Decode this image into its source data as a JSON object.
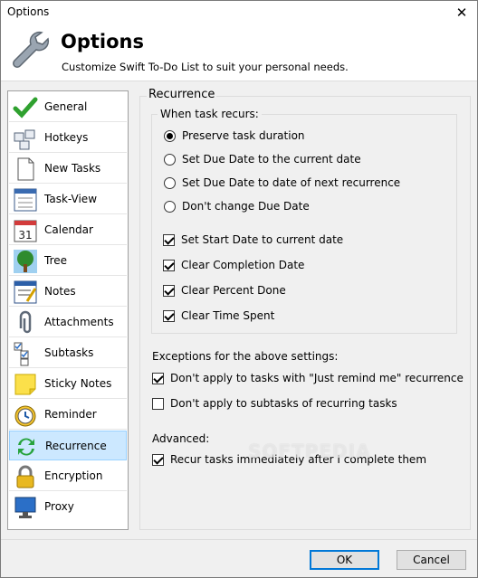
{
  "window": {
    "title": "Options",
    "close_glyph": "✕"
  },
  "header": {
    "title": "Options",
    "subtitle": "Customize Swift To-Do List to suit your personal needs.",
    "icon": "wrench-icon"
  },
  "sidebar": {
    "items": [
      {
        "label": "General",
        "icon": "checkmark-icon"
      },
      {
        "label": "Hotkeys",
        "icon": "keyboard-icon"
      },
      {
        "label": "New Tasks",
        "icon": "document-icon"
      },
      {
        "label": "Task-View",
        "icon": "task-view-icon"
      },
      {
        "label": "Calendar",
        "icon": "calendar-icon",
        "icon_text": "31"
      },
      {
        "label": "Tree",
        "icon": "tree-icon"
      },
      {
        "label": "Notes",
        "icon": "notes-icon"
      },
      {
        "label": "Attachments",
        "icon": "paperclip-icon"
      },
      {
        "label": "Subtasks",
        "icon": "subtasks-icon"
      },
      {
        "label": "Sticky Notes",
        "icon": "sticky-note-icon"
      },
      {
        "label": "Reminder",
        "icon": "alarm-clock-icon"
      },
      {
        "label": "Recurrence",
        "icon": "recurrence-icon",
        "selected": true
      },
      {
        "label": "Encryption",
        "icon": "padlock-icon"
      },
      {
        "label": "Proxy",
        "icon": "monitor-icon"
      }
    ]
  },
  "panel": {
    "title": "Recurrence",
    "when_recurs": {
      "title": "When task recurs:",
      "radios": [
        {
          "label": "Preserve task duration",
          "checked": true
        },
        {
          "label": "Set Due Date to the current date",
          "checked": false
        },
        {
          "label": "Set Due Date to date of next recurrence",
          "checked": false
        },
        {
          "label": "Don't change Due Date",
          "checked": false
        }
      ],
      "checks": [
        {
          "label": "Set Start Date to current date",
          "checked": true
        },
        {
          "label": "Clear Completion Date",
          "checked": true
        },
        {
          "label": "Clear Percent Done",
          "checked": true
        },
        {
          "label": "Clear Time Spent",
          "checked": true
        }
      ]
    },
    "exceptions": {
      "title": "Exceptions for the above settings:",
      "checks": [
        {
          "label": "Don't apply to tasks with \"Just remind me\" recurrence",
          "checked": true
        },
        {
          "label": "Don't apply to subtasks of recurring tasks",
          "checked": false
        }
      ]
    },
    "advanced": {
      "title": "Advanced:",
      "checks": [
        {
          "label": "Recur tasks immediately after I complete them",
          "checked": true
        }
      ]
    },
    "watermark": "SOFTPEDIA"
  },
  "footer": {
    "ok_label": "OK",
    "cancel_label": "Cancel"
  }
}
